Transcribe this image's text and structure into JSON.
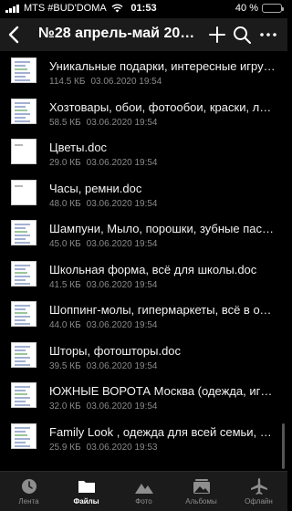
{
  "status_bar": {
    "carrier": "MTS #BUD'DOMA",
    "time": "01:53",
    "battery_percent": "40 %",
    "battery_level": 0.4
  },
  "header": {
    "title": "№28 апрель-май 2020..."
  },
  "files": [
    {
      "name": "Уникальные подарки, интересные игрушки.doc",
      "size": "114.5 КБ",
      "date": "03.06.2020 19:54",
      "thumb": "dense"
    },
    {
      "name": "Хозтовары, обои, фотообои, краски, люстры.doc",
      "size": "58.5 КБ",
      "date": "03.06.2020 19:54",
      "thumb": "dense"
    },
    {
      "name": "Цветы.doc",
      "size": "29.0 КБ",
      "date": "03.06.2020 19:54",
      "thumb": "blank"
    },
    {
      "name": "Часы, ремни.doc",
      "size": "48.0 КБ",
      "date": "03.06.2020 19:54",
      "thumb": "blank"
    },
    {
      "name": "Шампуни, Мыло, порошки, зубные пасты.doc",
      "size": "45.0 КБ",
      "date": "03.06.2020 19:54",
      "thumb": "dense"
    },
    {
      "name": "Школьная форма, всё для школы.doc",
      "size": "41.5 КБ",
      "date": "03.06.2020 19:54",
      "thumb": "dense"
    },
    {
      "name": "Шоппинг-молы, гипермаркеты, всё в одном.doc",
      "size": "44.0 КБ",
      "date": "03.06.2020 19:54",
      "thumb": "dense"
    },
    {
      "name": "Шторы, фотошторы.doc",
      "size": "39.5 КБ",
      "date": "03.06.2020 19:54",
      "thumb": "dense"
    },
    {
      "name": "ЮЖНЫЕ ВОРОТА Москва (одежда, игрушки).doc",
      "size": "32.0 КБ",
      "date": "03.06.2020 19:54",
      "thumb": "dense"
    },
    {
      "name": "Family Look , одежда для всей семьи, женская.doc",
      "size": "25.9 КБ",
      "date": "03.06.2020 19:53",
      "thumb": "dense"
    }
  ],
  "tabs": [
    {
      "label": "Лента",
      "icon": "clock-icon",
      "active": false
    },
    {
      "label": "Файлы",
      "icon": "folder-icon",
      "active": true
    },
    {
      "label": "Фото",
      "icon": "mountain-icon",
      "active": false
    },
    {
      "label": "Альбомы",
      "icon": "albums-icon",
      "active": false
    },
    {
      "label": "Офлайн",
      "icon": "airplane-icon",
      "active": false
    }
  ],
  "colors": {
    "background": "#000000",
    "nav_background": "#1b1b1b",
    "meta_text": "#8a8a8a",
    "tab_inactive": "#8e8e8e",
    "tab_active": "#ffffff"
  }
}
